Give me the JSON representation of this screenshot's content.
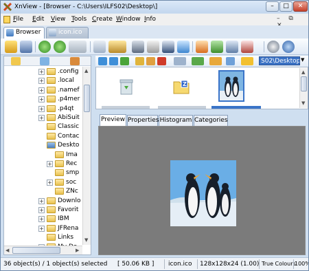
{
  "window": {
    "title": "XnView - [Browser - C:\\Users\\ILFS02\\Desktop\\]",
    "min": "–",
    "max": "□",
    "close": "✕"
  },
  "menu": [
    "File",
    "Edit",
    "View",
    "Tools",
    "Create",
    "Window",
    "Info"
  ],
  "menu_controls": "–  ⧉  ✕",
  "tabs": [
    {
      "label": "Browser"
    },
    {
      "label": "icon.ico"
    }
  ],
  "path": "S02\\Desktop\\",
  "tree": [
    {
      "label": ".config",
      "plus": true
    },
    {
      "label": ".local",
      "plus": true
    },
    {
      "label": ".namef",
      "plus": true
    },
    {
      "label": ".p4mer",
      "plus": true
    },
    {
      "label": ".p4qt",
      "plus": true
    },
    {
      "label": "AbiSuit",
      "plus": true
    },
    {
      "label": "Classic",
      "plus": false
    },
    {
      "label": "Contac",
      "plus": false
    },
    {
      "label": "Deskto",
      "plus": false,
      "open": true
    },
    {
      "label": "Ima",
      "plus": false,
      "child": true
    },
    {
      "label": "Rec",
      "plus": true,
      "child": true
    },
    {
      "label": "smp",
      "plus": false,
      "child": true
    },
    {
      "label": "soc",
      "plus": true,
      "child": true
    },
    {
      "label": "ZNc",
      "plus": false,
      "child": true
    },
    {
      "label": "Downlo",
      "plus": true
    },
    {
      "label": "Favorit",
      "plus": true
    },
    {
      "label": "IBM",
      "plus": true
    },
    {
      "label": "JFRena",
      "plus": true
    },
    {
      "label": "Links",
      "plus": false
    },
    {
      "label": "My Do",
      "plus": true
    }
  ],
  "view_tabs": [
    "Preview",
    "Properties",
    "Histogram",
    "Categories"
  ],
  "status": {
    "objects": "36 object(s) / 1 object(s) selected",
    "size": "[ 50.06 KB ]",
    "file": "icon.ico",
    "dims": "128x128x24 (1.00)",
    "colours": "True Colours",
    "filesize": "50.06 KB",
    "zoom": "100%"
  }
}
